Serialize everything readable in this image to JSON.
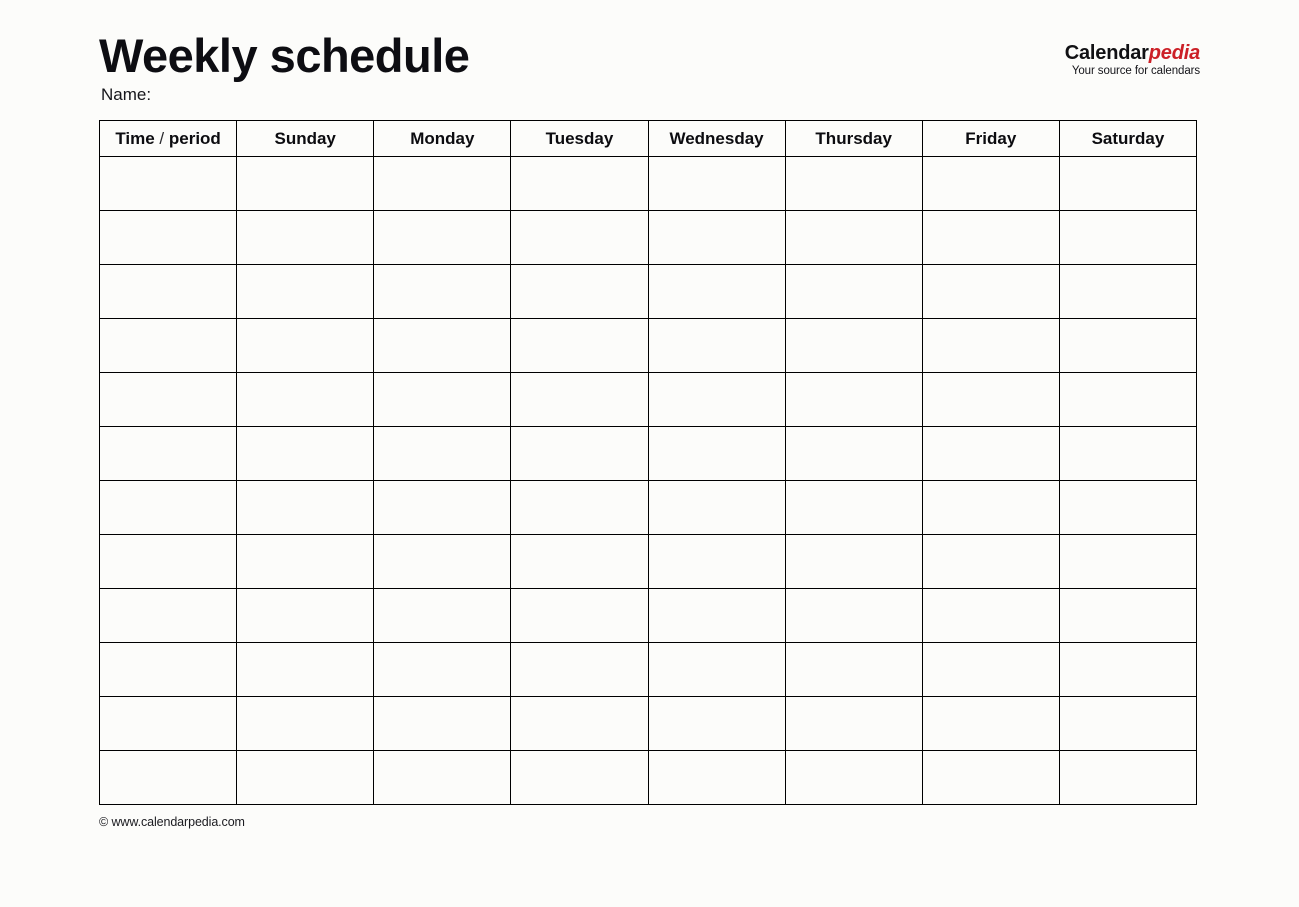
{
  "document": {
    "title": "Weekly schedule",
    "name_label": "Name:",
    "footer": "© www.calendarpedia.com"
  },
  "brand": {
    "name_primary": "Calendar",
    "name_accent": "pedia",
    "tagline": "Your source for calendars",
    "accent_color": "#cc2027",
    "primary_color": "#111114"
  },
  "schedule": {
    "columns": [
      "Time / period",
      "Sunday",
      "Monday",
      "Tuesday",
      "Wednesday",
      "Thursday",
      "Friday",
      "Saturday"
    ],
    "row_count": 12,
    "rows": [
      [
        "",
        "",
        "",
        "",
        "",
        "",
        "",
        ""
      ],
      [
        "",
        "",
        "",
        "",
        "",
        "",
        "",
        ""
      ],
      [
        "",
        "",
        "",
        "",
        "",
        "",
        "",
        ""
      ],
      [
        "",
        "",
        "",
        "",
        "",
        "",
        "",
        ""
      ],
      [
        "",
        "",
        "",
        "",
        "",
        "",
        "",
        ""
      ],
      [
        "",
        "",
        "",
        "",
        "",
        "",
        "",
        ""
      ],
      [
        "",
        "",
        "",
        "",
        "",
        "",
        "",
        ""
      ],
      [
        "",
        "",
        "",
        "",
        "",
        "",
        "",
        ""
      ],
      [
        "",
        "",
        "",
        "",
        "",
        "",
        "",
        ""
      ],
      [
        "",
        "",
        "",
        "",
        "",
        "",
        "",
        ""
      ],
      [
        "",
        "",
        "",
        "",
        "",
        "",
        "",
        ""
      ],
      [
        "",
        "",
        "",
        "",
        "",
        "",
        "",
        ""
      ]
    ]
  }
}
